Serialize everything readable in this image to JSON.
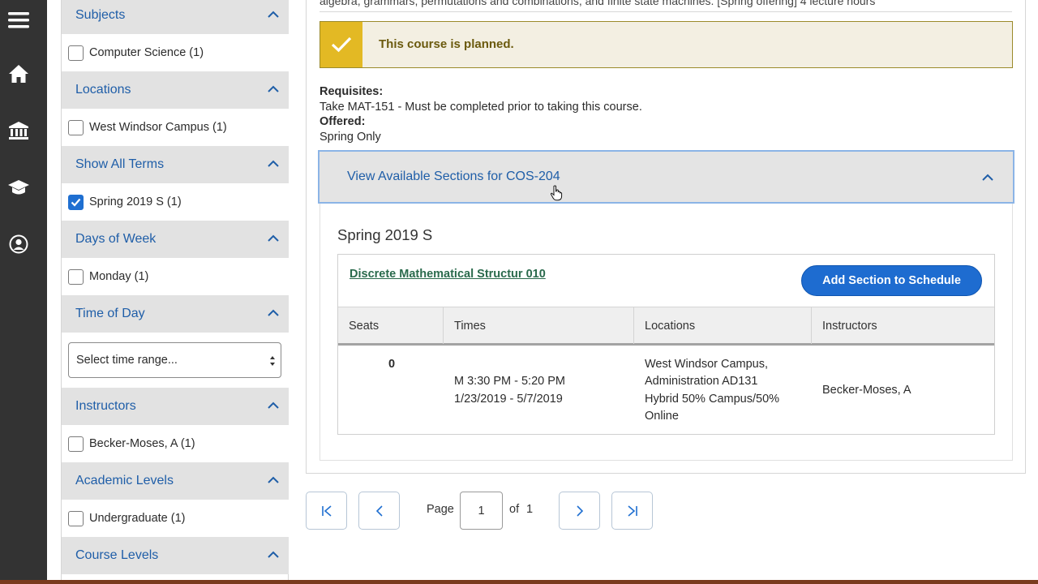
{
  "rail": {
    "icons": [
      "menu-icon",
      "home-icon",
      "institution-icon",
      "graduation-cap-icon",
      "user-icon"
    ]
  },
  "filters": {
    "groups": [
      {
        "label": "Subjects",
        "items": [
          {
            "label": "Computer Science (1)",
            "checked": false
          }
        ]
      },
      {
        "label": "Locations",
        "items": [
          {
            "label": "West Windsor Campus (1)",
            "checked": false
          }
        ]
      },
      {
        "label": "Show All Terms",
        "items": [
          {
            "label": "Spring 2019 S (1)",
            "checked": true
          }
        ]
      },
      {
        "label": "Days of Week",
        "items": [
          {
            "label": "Monday (1)",
            "checked": false
          }
        ]
      },
      {
        "label": "Time of Day",
        "select_value": "Select time range..."
      },
      {
        "label": "Instructors",
        "items": [
          {
            "label": "Becker-Moses, A (1)",
            "checked": false
          }
        ]
      },
      {
        "label": "Academic Levels",
        "items": [
          {
            "label": "Undergraduate (1)",
            "checked": false
          }
        ]
      },
      {
        "label": "Course Levels"
      }
    ]
  },
  "course": {
    "description_tail": "algebra, grammars, permutations and combinations, and finite state machines. [Spring offering] 4 lecture hours",
    "alert": "This course is planned.",
    "requisites_label": "Requisites:",
    "requisites_text": "Take MAT-151 - Must be completed prior to taking this course.",
    "offered_label": "Offered:",
    "offered_text": "Spring Only"
  },
  "sections": {
    "header": "View Available Sections for COS-204",
    "term": "Spring 2019 S",
    "section_name": "Discrete Mathematical Structur 010",
    "add_button": "Add Section to Schedule",
    "columns": [
      "Seats",
      "Times",
      "Locations",
      "Instructors"
    ],
    "row": {
      "seats": "0",
      "times_line1": "M 3:30 PM - 5:20 PM",
      "times_line2": "1/23/2019 - 5/7/2019",
      "location_line1": "West Windsor Campus,",
      "location_line2": "Administration AD131",
      "location_line3": "Hybrid 50% Campus/50%",
      "location_line4": "Online",
      "instructor": "Becker-Moses, A"
    }
  },
  "pager": {
    "page_label": "Page",
    "current": "1",
    "of_label": "of",
    "total": "1"
  },
  "colors": {
    "rail": "#333333",
    "link_blue": "#1f5ea8",
    "primary_button": "#1e6cd0",
    "alert_icon": "#e3b924",
    "section_link": "#2a6a4c"
  }
}
